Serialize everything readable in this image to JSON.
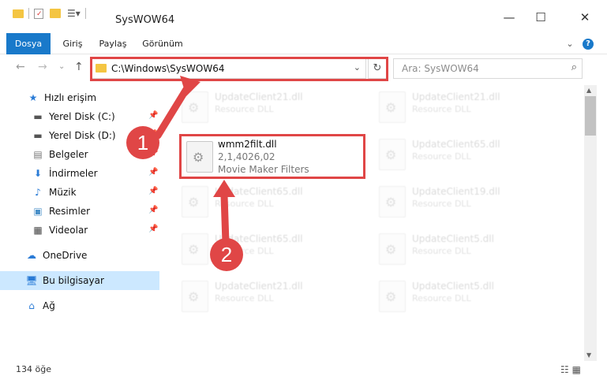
{
  "window": {
    "title": "SysWOW64",
    "minimize": "—",
    "maximize": "☐",
    "close": "✕"
  },
  "ribbon": {
    "tabs": [
      "Dosya",
      "Giriş",
      "Paylaş",
      "Görünüm"
    ],
    "active_tab": "Dosya",
    "expand": "⌄",
    "help": "?"
  },
  "nav": {
    "back": "←",
    "forward": "→",
    "recent": "⌄",
    "up": "↑",
    "address": "C:\\Windows\\SysWOW64",
    "address_dropdown": "⌄",
    "refresh": "↻",
    "search_placeholder": "Ara: SysWOW64",
    "search_icon": "⌕"
  },
  "sidebar": {
    "items": [
      {
        "label": "Hızlı erişim",
        "icon": "star-icon"
      },
      {
        "label": "Yerel Disk (C:)",
        "icon": "drive-icon",
        "pinned": true
      },
      {
        "label": "Yerel Disk (D:)",
        "icon": "drive-icon",
        "pinned": true
      },
      {
        "label": "Belgeler",
        "icon": "documents-icon",
        "pinned": true
      },
      {
        "label": "İndirmeler",
        "icon": "download-icon",
        "pinned": true
      },
      {
        "label": "Müzik",
        "icon": "music-icon",
        "pinned": true
      },
      {
        "label": "Resimler",
        "icon": "pictures-icon",
        "pinned": true
      },
      {
        "label": "Videolar",
        "icon": "video-icon",
        "pinned": true
      },
      {
        "label": "OneDrive",
        "icon": "cloud-icon"
      },
      {
        "label": "Bu bilgisayar",
        "icon": "computer-icon",
        "selected": true
      },
      {
        "label": "Ağ",
        "icon": "network-icon"
      }
    ]
  },
  "files": {
    "background": [
      {
        "name": "UpdateClient21.dll",
        "desc": "Resource DLL"
      },
      {
        "name": "UpdateClient21.dll",
        "desc": "Resource DLL"
      },
      {
        "name": "UpdateClient65.dll",
        "desc": "Resource DLL"
      },
      {
        "name": "UpdateClient65.dll",
        "desc": "Resource DLL"
      },
      {
        "name": "UpdateClient19.dll",
        "desc": "Resource DLL"
      },
      {
        "name": "UpdateClient65.dll",
        "desc": "Resource DLL"
      },
      {
        "name": "UpdateClient5.dll",
        "desc": "Resource DLL"
      },
      {
        "name": "UpdateClient21.dll",
        "desc": "Resource DLL"
      },
      {
        "name": "UpdateClient5.dll",
        "desc": "Resource DLL"
      }
    ],
    "highlighted": {
      "name": "wmm2filt.dll",
      "version": "2,1,4026,02",
      "description": "Movie Maker Filters"
    }
  },
  "callouts": [
    "1",
    "2"
  ],
  "status": {
    "item_count": "134 öğe",
    "views": "☷ ▦"
  },
  "colors": {
    "accent": "#1979ca",
    "highlight": "#e04646",
    "selection": "#cce8ff"
  }
}
